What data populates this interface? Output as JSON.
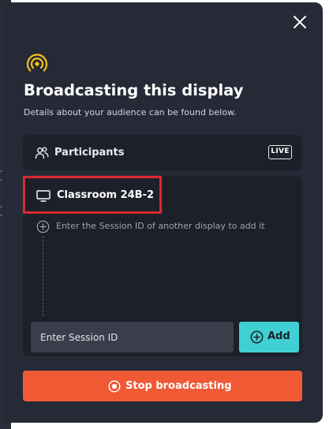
{
  "modal": {
    "title": "Broadcasting this display",
    "subtitle": "Details about your audience can be found below.",
    "close_icon": "close-icon",
    "broadcast_icon": "broadcast-icon",
    "accent_color": "#f5c518"
  },
  "participants": {
    "label": "Participants",
    "icon": "participants-icon",
    "badge": "LIVE"
  },
  "audience": {
    "display_item": {
      "label": "Classroom 24B-2",
      "icon": "monitor-icon",
      "highlight_color": "#d92a30"
    },
    "add_hint": {
      "text": "Enter the Session ID of another display to add it",
      "icon": "plus-circle-icon"
    },
    "session_input": {
      "placeholder": "Enter Session ID",
      "value": ""
    },
    "add_button": {
      "label": "Add",
      "icon": "plus-circle-icon",
      "color": "#40d0d3"
    }
  },
  "stop_button": {
    "label": "Stop broadcasting",
    "icon": "stop-circle-icon",
    "color": "#ef5a35"
  }
}
